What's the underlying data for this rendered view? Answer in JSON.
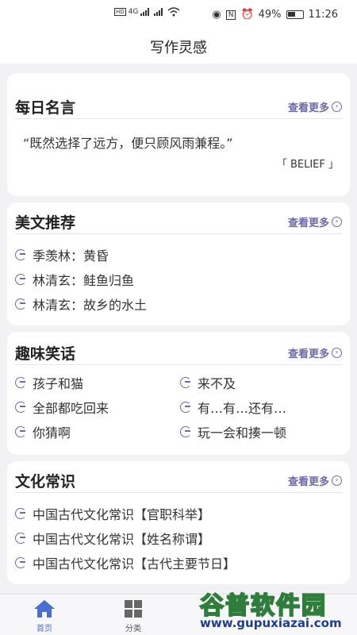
{
  "status_bar": {
    "signal": "4G",
    "battery": "49%",
    "time": "11:26"
  },
  "header": {
    "title": "写作灵感"
  },
  "daily_quote": {
    "title": "每日名言",
    "more": "查看更多",
    "quote": "“既然选择了远方，便只顾风雨兼程。”",
    "author": "「 BELIEF 」"
  },
  "essays": {
    "title": "美文推荐",
    "more": "查看更多",
    "items": [
      "季羡林：黄昏",
      "林清玄：鲑鱼归鱼",
      "林清玄：故乡的水土"
    ]
  },
  "jokes": {
    "title": "趣味笑话",
    "more": "查看更多",
    "items": [
      "孩子和猫",
      "来不及",
      "全部都吃回来",
      "有…有…还有…",
      "你猜啊",
      "玩一会和揍一顿"
    ]
  },
  "culture": {
    "title": "文化常识",
    "more": "查看更多",
    "items": [
      "中国古代文化常识【官职科举】",
      "中国古代文化常识【姓名称谓】",
      "中国古代文化常识【古代主要节日】"
    ]
  },
  "tabs": [
    {
      "label": "首页",
      "icon": "home-icon",
      "active": true
    },
    {
      "label": "分类",
      "icon": "grid-icon",
      "active": false
    }
  ],
  "watermark": {
    "name": "谷普软件园",
    "url": "www.gupuxiazai.com"
  },
  "colors": {
    "accent": "#6c6aa8",
    "tab_active": "#4a6fd4",
    "background": "#f2f2f4"
  }
}
